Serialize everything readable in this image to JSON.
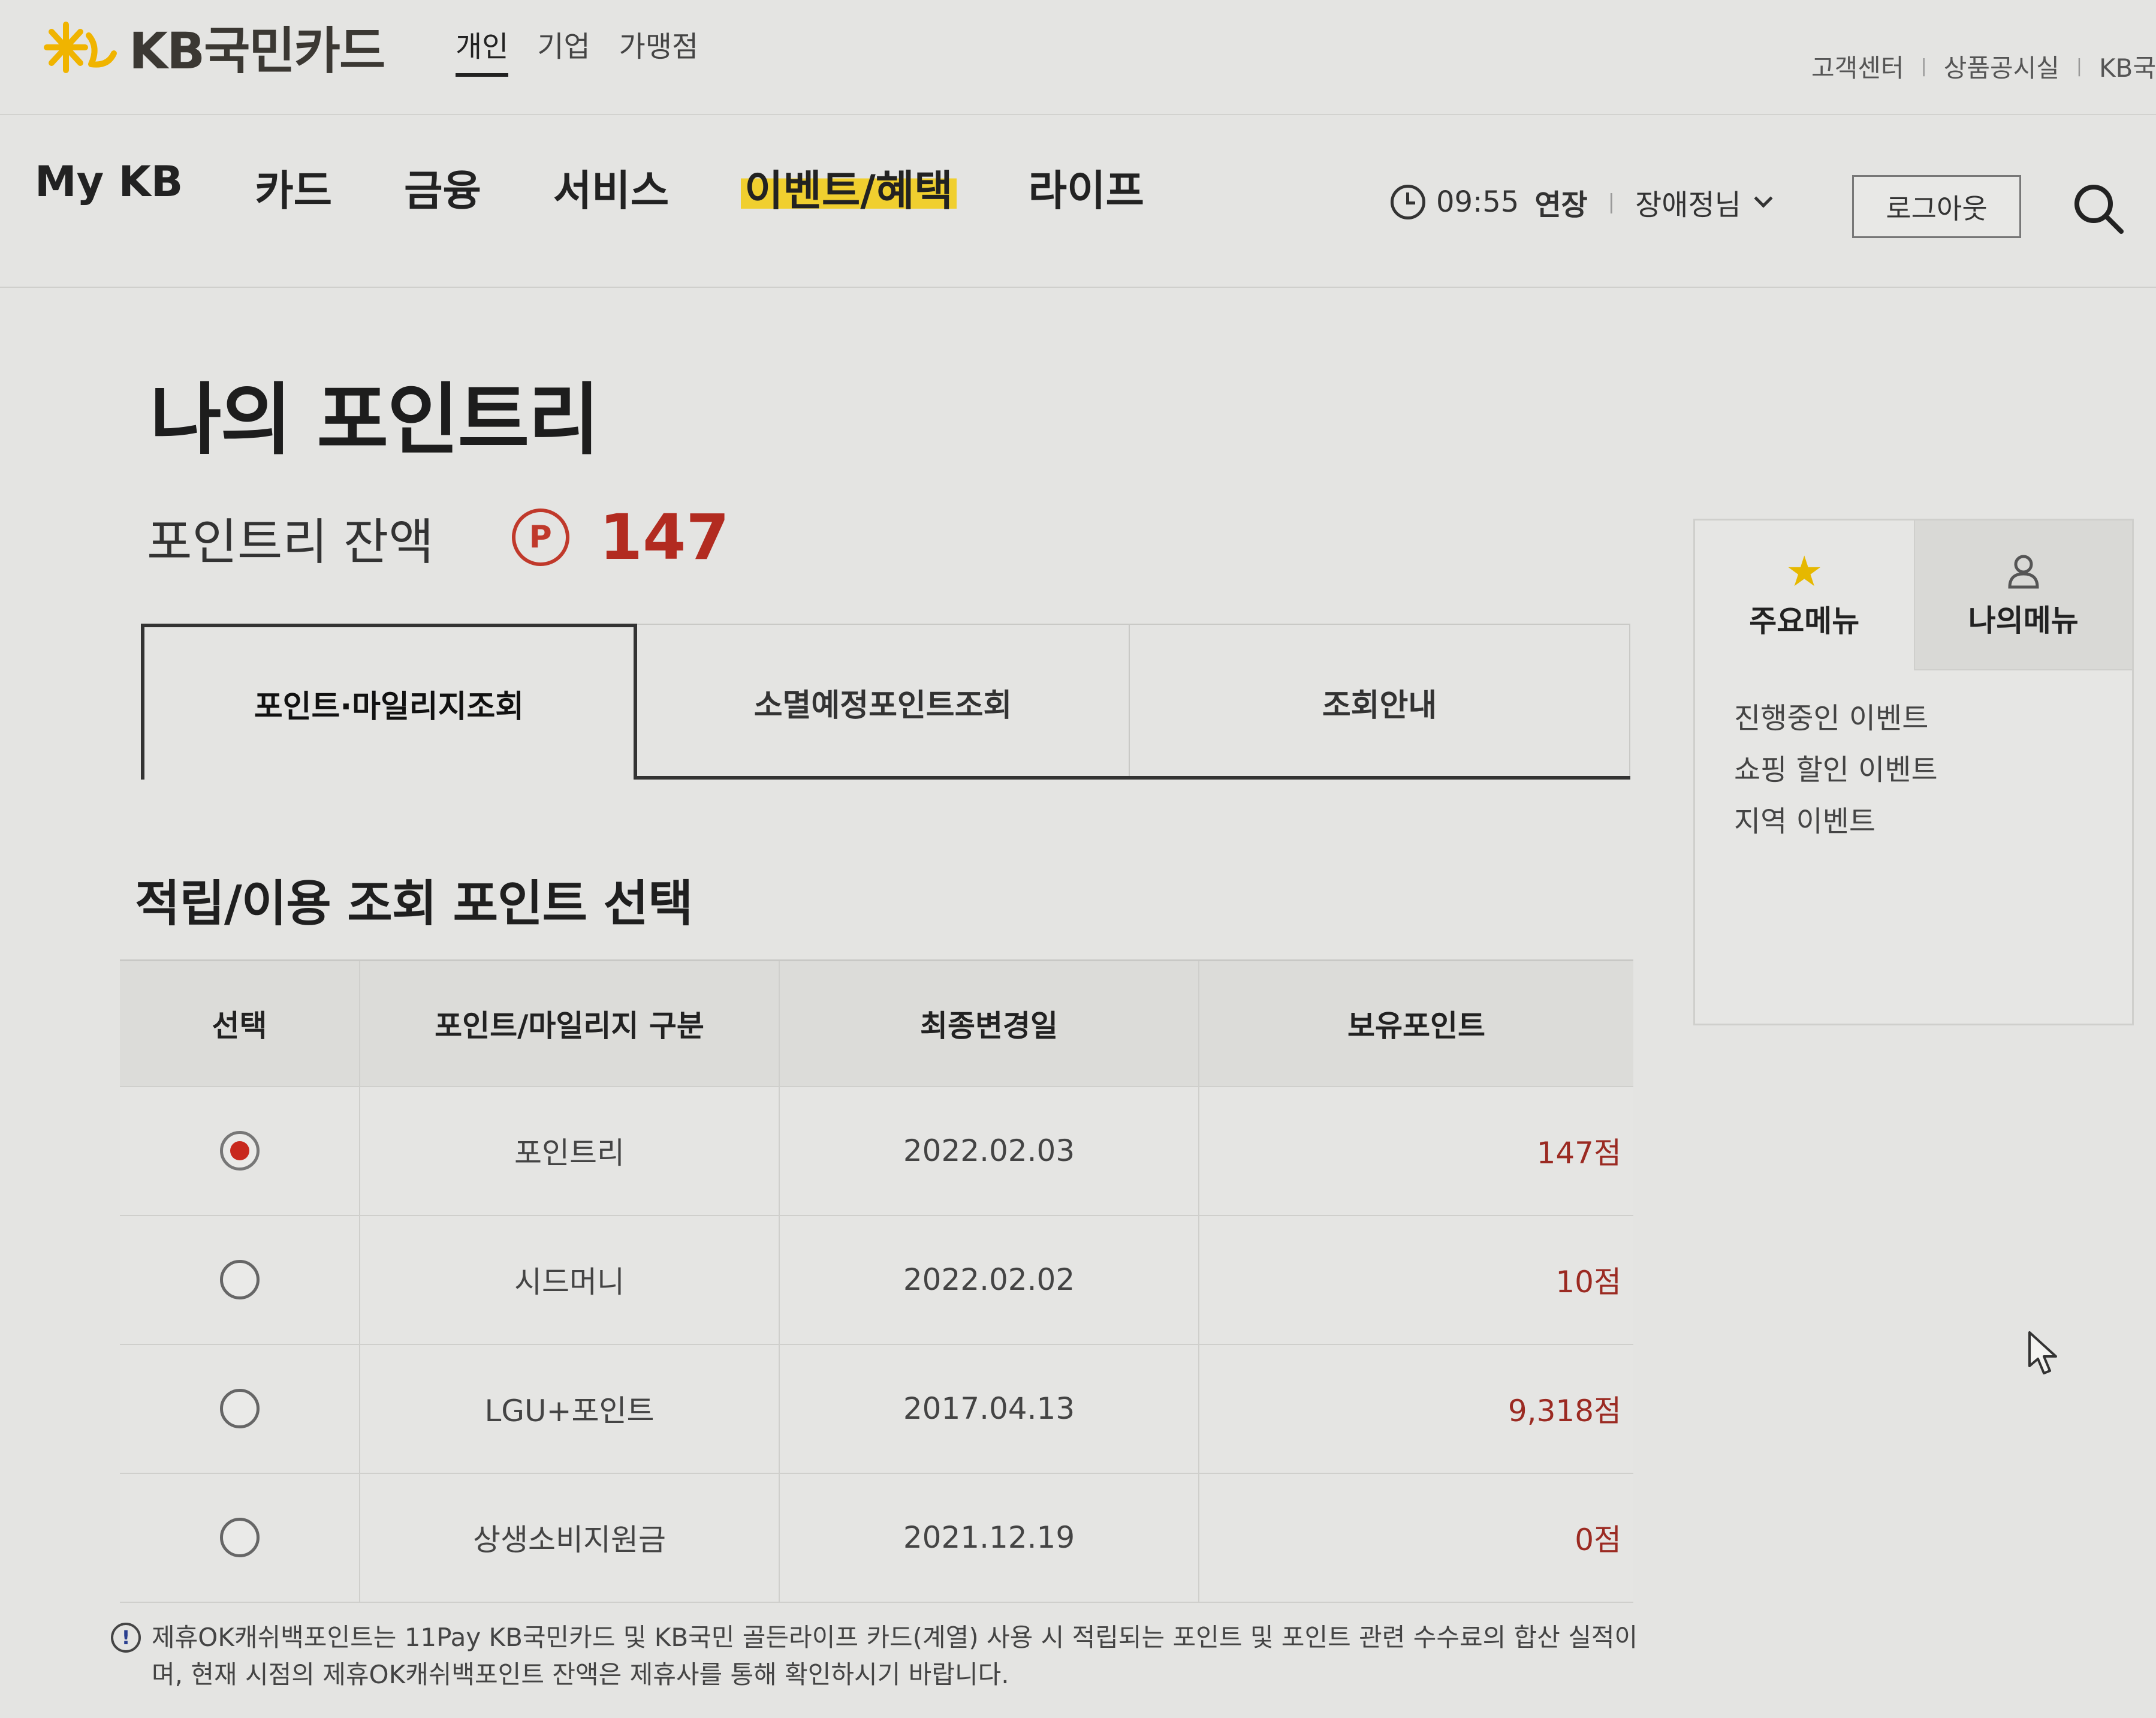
{
  "brand": {
    "name": "KB국민카드",
    "logo_color": "#f0b400"
  },
  "top_tabs": [
    {
      "label": "개인",
      "active": true
    },
    {
      "label": "기업",
      "active": false
    },
    {
      "label": "가맹점",
      "active": false
    }
  ],
  "util_links": [
    "고객센터",
    "상품공시실",
    "KB국"
  ],
  "nav": {
    "items": [
      {
        "label": "My KB"
      },
      {
        "label": "카드"
      },
      {
        "label": "금융"
      },
      {
        "label": "서비스"
      },
      {
        "label": "이벤트/혜택",
        "highlighted": true
      },
      {
        "label": "라이프"
      }
    ],
    "session_time": "09:55",
    "extend_label": "연장",
    "user_name": "장애정님",
    "logout_label": "로그아웃",
    "highlight_color": "#f0cf2f"
  },
  "page": {
    "title": "나의 포인트리",
    "balance_label": "포인트리 잔액",
    "balance_icon": "P",
    "balance_value": "147",
    "accent_color": "#b22b20"
  },
  "tabs": [
    {
      "label": "포인트·마일리지조회",
      "active": true
    },
    {
      "label": "소멸예정포인트조회",
      "active": false
    },
    {
      "label": "조회안내",
      "active": false
    }
  ],
  "section": {
    "title": "적립/이용 조회 포인트 선택"
  },
  "table": {
    "headers": [
      "선택",
      "포인트/마일리지 구분",
      "최종변경일",
      "보유포인트"
    ],
    "rows": [
      {
        "selected": true,
        "type": "포인트리",
        "date": "2022.02.03",
        "points": "147점"
      },
      {
        "selected": false,
        "type": "시드머니",
        "date": "2022.02.02",
        "points": "10점"
      },
      {
        "selected": false,
        "type": "LGU+포인트",
        "date": "2017.04.13",
        "points": "9,318점"
      },
      {
        "selected": false,
        "type": "상생소비지원금",
        "date": "2021.12.19",
        "points": "0점"
      }
    ]
  },
  "note": {
    "icon": "!",
    "text": "제휴OK캐쉬백포인트는 11Pay KB국민카드 및 KB국민 골든라이프 카드(계열) 사용 시 적립되는 포인트 및 포인트 관련 수수료의 합산 실적이며, 현재 시점의 제휴OK캐쉬백포인트 잔액은 제휴사를 통해 확인하시기 바랍니다."
  },
  "side_panel": {
    "tabs": [
      {
        "label": "주요메뉴",
        "icon": "star-icon",
        "active": true
      },
      {
        "label": "나의메뉴",
        "icon": "person-icon",
        "active": false
      }
    ],
    "links": [
      "진행중인 이벤트",
      "쇼핑 할인 이벤트",
      "지역 이벤트"
    ]
  }
}
